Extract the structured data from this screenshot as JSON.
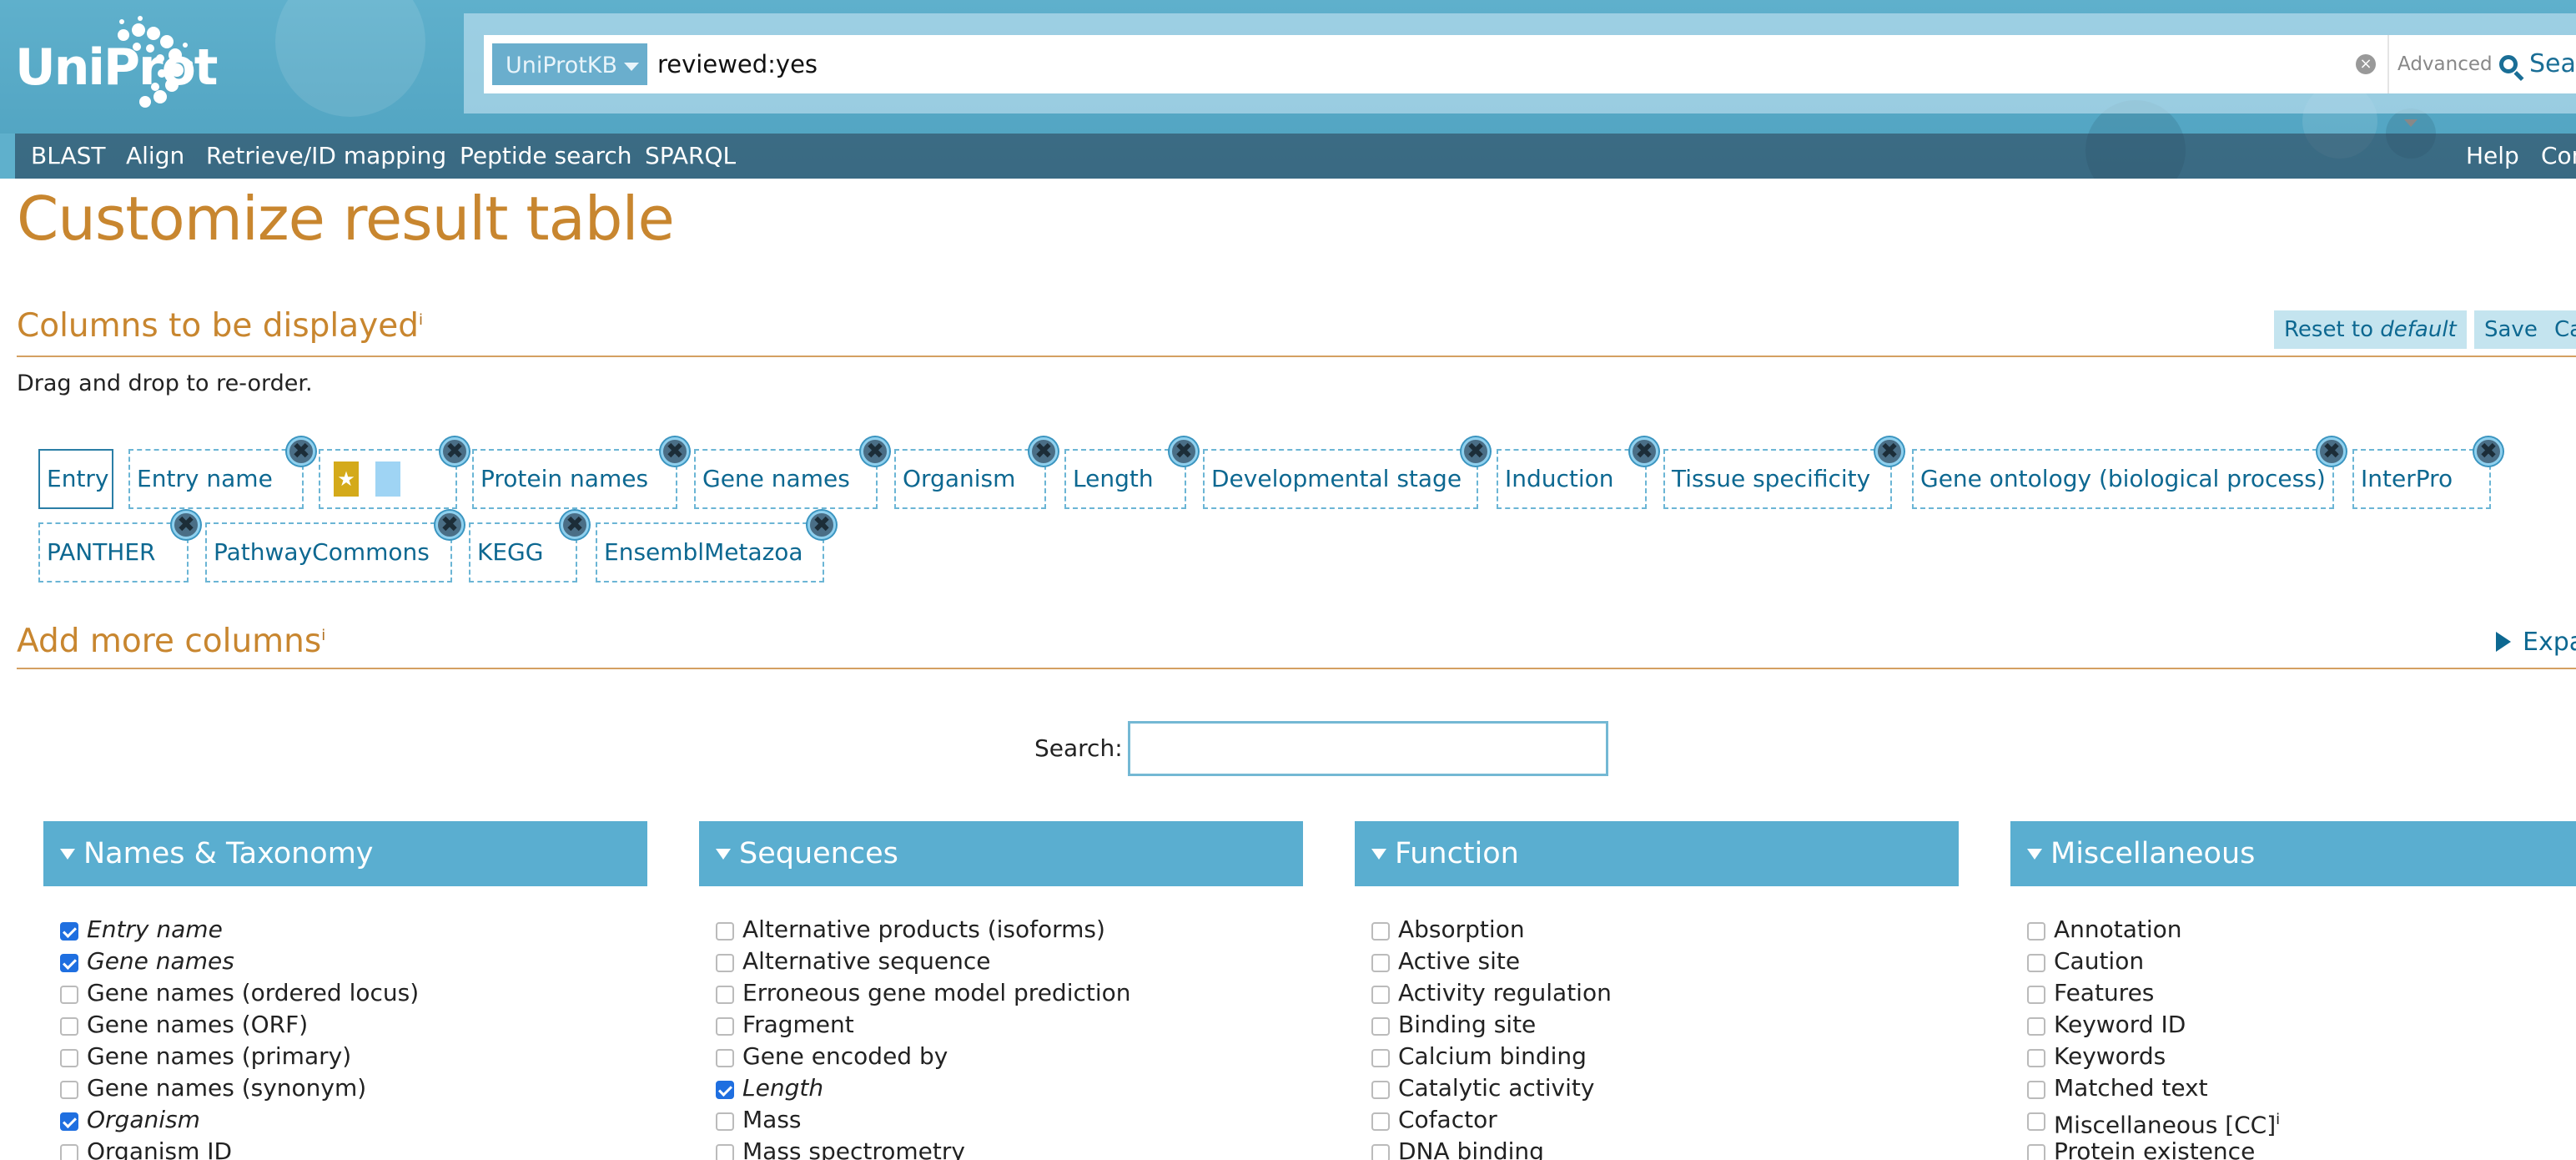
{
  "header": {
    "logo_text": "UniProt",
    "database": "UniProtKB",
    "query": "reviewed:yes",
    "clear_symbol": "×",
    "advanced_label": "Advanced",
    "search_label": "Search"
  },
  "nav": {
    "left": [
      "BLAST",
      "Align",
      "Retrieve/ID mapping",
      "Peptide search",
      "SPARQL"
    ],
    "right": [
      "Help",
      "Contact"
    ]
  },
  "page_title": "Customize result table",
  "columns_section": {
    "title": "Columns to be displayed",
    "info": "i",
    "hint": "Drag and drop to re-order.",
    "reset_label": "Reset to ",
    "reset_default": "default",
    "save_label": "Save",
    "cancel_label": "Cancel",
    "remove_symbol": "✖",
    "chips": [
      "Entry",
      "Entry name",
      "",
      "Protein names",
      "Gene names",
      "Organism",
      "Length",
      "Developmental stage",
      "Induction",
      "Tissue specificity",
      "Gene ontology (biological process)",
      "InterPro",
      "PANTHER",
      "PathwayCommons",
      "KEGG",
      "EnsemblMetazoa"
    ]
  },
  "add_section": {
    "title": "Add more columns",
    "info": "i",
    "expand_label": "Expand all",
    "search_label": "Search:",
    "search_value": ""
  },
  "groups": [
    {
      "title": "Names & Taxonomy",
      "options": [
        {
          "label": "Entry name",
          "checked": true
        },
        {
          "label": "Gene names",
          "checked": true
        },
        {
          "label": "Gene names (ordered locus)",
          "checked": false
        },
        {
          "label": "Gene names (ORF)",
          "checked": false
        },
        {
          "label": "Gene names (primary)",
          "checked": false
        },
        {
          "label": "Gene names (synonym)",
          "checked": false
        },
        {
          "label": "Organism",
          "checked": true
        },
        {
          "label": "Organism ID",
          "checked": false
        }
      ]
    },
    {
      "title": "Sequences",
      "options": [
        {
          "label": "Alternative products (isoforms)",
          "checked": false
        },
        {
          "label": "Alternative sequence",
          "checked": false
        },
        {
          "label": "Erroneous gene model prediction",
          "checked": false
        },
        {
          "label": "Fragment",
          "checked": false
        },
        {
          "label": "Gene encoded by",
          "checked": false
        },
        {
          "label": "Length",
          "checked": true
        },
        {
          "label": "Mass",
          "checked": false
        },
        {
          "label": "Mass spectrometry",
          "checked": false
        }
      ]
    },
    {
      "title": "Function",
      "options": [
        {
          "label": "Absorption",
          "checked": false
        },
        {
          "label": "Active site",
          "checked": false
        },
        {
          "label": "Activity regulation",
          "checked": false
        },
        {
          "label": "Binding site",
          "checked": false
        },
        {
          "label": "Calcium binding",
          "checked": false
        },
        {
          "label": "Catalytic activity",
          "checked": false
        },
        {
          "label": "Cofactor",
          "checked": false
        },
        {
          "label": "DNA binding",
          "checked": false
        }
      ]
    },
    {
      "title": "Miscellaneous",
      "options": [
        {
          "label": "Annotation",
          "checked": false
        },
        {
          "label": "Caution",
          "checked": false
        },
        {
          "label": "Features",
          "checked": false
        },
        {
          "label": "Keyword ID",
          "checked": false
        },
        {
          "label": "Keywords",
          "checked": false
        },
        {
          "label": "Matched text",
          "checked": false
        },
        {
          "label": "Miscellaneous [CC]",
          "checked": false,
          "info": "i"
        },
        {
          "label": "Protein existence",
          "checked": false
        }
      ]
    }
  ],
  "colors": {
    "accent_orange": "#c8862f",
    "link_blue": "#0d6891",
    "header_blue": "#5fb0cc",
    "group_blue": "#5aaed0"
  }
}
